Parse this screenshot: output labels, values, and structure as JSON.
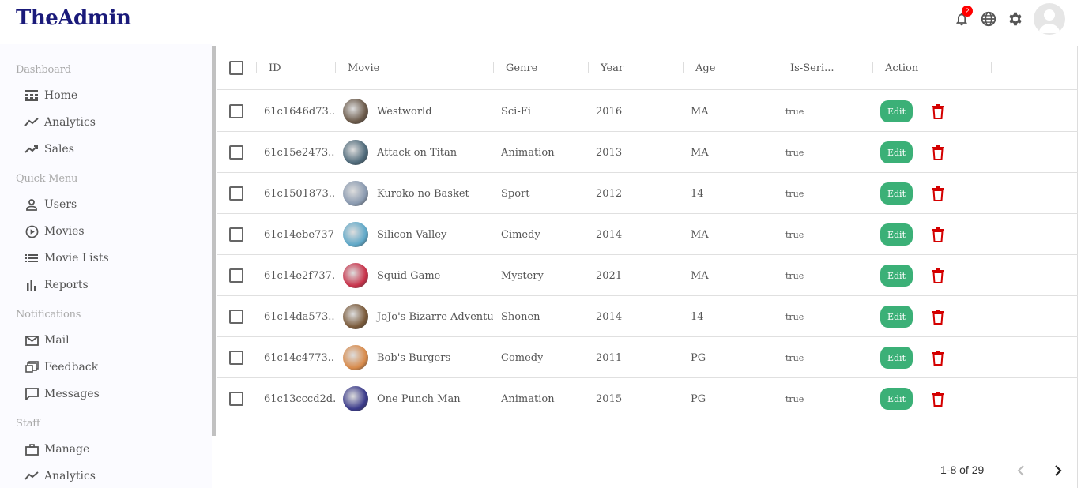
{
  "app": {
    "logo": "TheAdmin"
  },
  "topbar": {
    "notification_count": "2",
    "icons": [
      "bell-icon",
      "globe-icon",
      "gear-icon",
      "avatar"
    ]
  },
  "sidebar": {
    "sections": [
      {
        "title": "Dashboard",
        "items": [
          {
            "label": "Home",
            "icon": "home-icon"
          },
          {
            "label": "Analytics",
            "icon": "trend-icon"
          },
          {
            "label": "Sales",
            "icon": "trend-up-icon"
          }
        ]
      },
      {
        "title": "Quick Menu",
        "items": [
          {
            "label": "Users",
            "icon": "user-icon"
          },
          {
            "label": "Movies",
            "icon": "play-icon"
          },
          {
            "label": "Movie Lists",
            "icon": "list-icon"
          },
          {
            "label": "Reports",
            "icon": "bar-chart-icon"
          }
        ]
      },
      {
        "title": "Notifications",
        "items": [
          {
            "label": "Mail",
            "icon": "mail-icon"
          },
          {
            "label": "Feedback",
            "icon": "feedback-icon"
          },
          {
            "label": "Messages",
            "icon": "message-icon"
          }
        ]
      },
      {
        "title": "Staff",
        "items": [
          {
            "label": "Manage",
            "icon": "briefcase-icon"
          },
          {
            "label": "Analytics",
            "icon": "trend-icon"
          }
        ]
      }
    ]
  },
  "table": {
    "columns": [
      "ID",
      "Movie",
      "Genre",
      "Year",
      "Age",
      "Is-Seri...",
      "Action"
    ],
    "edit_label": "Edit",
    "rows": [
      {
        "id": "61c1646d73...",
        "movie": "Westworld",
        "genre": "Sci-Fi",
        "year": "2016",
        "age": "MA",
        "series": "true",
        "color": "#6b5a4a"
      },
      {
        "id": "61c15e2473...",
        "movie": "Attack on Titan",
        "genre": "Animation",
        "year": "2013",
        "age": "MA",
        "series": "true",
        "color": "#4f6a7a"
      },
      {
        "id": "61c1501873...",
        "movie": "Kuroko no Basket",
        "genre": "Sport",
        "year": "2012",
        "age": "14",
        "series": "true",
        "color": "#8a9ab0"
      },
      {
        "id": "61c14ebe737...",
        "movie": "Silicon Valley",
        "genre": "Cimedy",
        "year": "2014",
        "age": "MA",
        "series": "true",
        "color": "#5fa8c8"
      },
      {
        "id": "61c14e2f737...",
        "movie": "Squid Game",
        "genre": "Mystery",
        "year": "2021",
        "age": "MA",
        "series": "true",
        "color": "#c8324a"
      },
      {
        "id": "61c14da573...",
        "movie": "JoJo's Bizarre Adventure: S",
        "genre": "Shonen",
        "year": "2014",
        "age": "14",
        "series": "true",
        "color": "#7a5a3a"
      },
      {
        "id": "61c14c4773...",
        "movie": "Bob's Burgers",
        "genre": "Comedy",
        "year": "2011",
        "age": "PG",
        "series": "true",
        "color": "#d88a4a"
      },
      {
        "id": "61c13cccd2d...",
        "movie": "One Punch Man",
        "genre": "Animation",
        "year": "2015",
        "age": "PG",
        "series": "true",
        "color": "#3a3a8a"
      }
    ]
  },
  "pagination": {
    "text": "1-8 of 29"
  }
}
